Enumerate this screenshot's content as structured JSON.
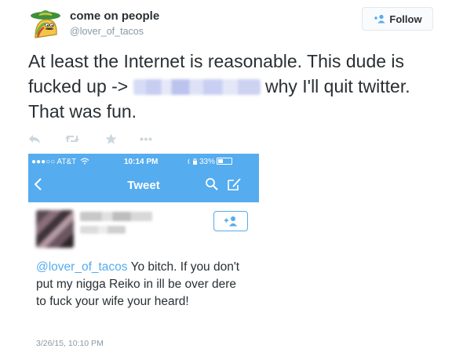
{
  "tweet": {
    "author": {
      "display_name": "come on people",
      "handle": "@lover_of_tacos",
      "avatar_icon": "taco-cartoon-avatar"
    },
    "follow_button": {
      "label": "Follow",
      "icon": "add-user-icon"
    },
    "text_before_link": "At least the Internet is reasonable. This dude is fucked up -> ",
    "text_after_link": " why I'll quit twitter. That was fun.",
    "actions": [
      {
        "name": "reply",
        "icon": "reply-icon"
      },
      {
        "name": "retweet",
        "icon": "retweet-icon"
      },
      {
        "name": "favorite",
        "icon": "star-icon"
      },
      {
        "name": "more",
        "icon": "more-icon"
      }
    ]
  },
  "embedded_screenshot": {
    "status_bar": {
      "carrier": "●●●○○ AT&T",
      "time": "10:14 PM",
      "battery": "33%"
    },
    "nav": {
      "title": "Tweet",
      "back_icon": "chevron-left-icon",
      "search_icon": "search-icon",
      "compose_icon": "compose-icon"
    },
    "follow_icon": "add-user-icon",
    "tweet": {
      "mention": "@lover_of_tacos",
      "text": " Yo bitch. If you don't put my nigga Reiko in ill be over dere to fuck your wife your heard!",
      "timestamp": "3/26/15, 10:10 PM"
    }
  },
  "colors": {
    "twitter_blue": "#55acee",
    "text": "#292f33",
    "muted": "#8899a6",
    "icon_gray": "#ccd6dd"
  }
}
